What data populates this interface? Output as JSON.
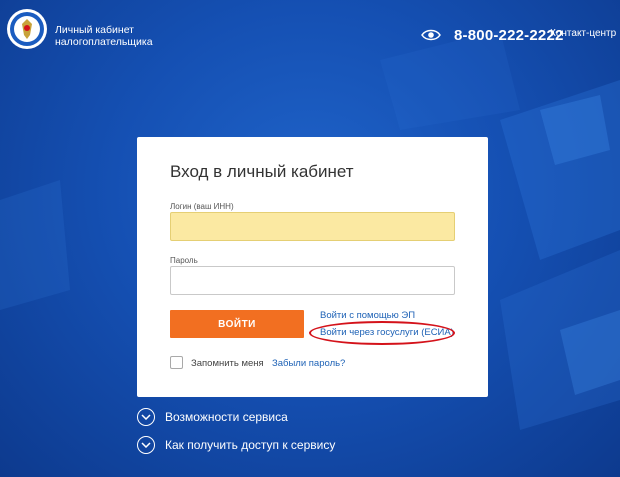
{
  "header": {
    "brand_line1": "Личный кабинет",
    "brand_line2": "налогоплательщика",
    "phone": "8-800-222-2222",
    "contact_center": "Контакт-центр",
    "icons": {
      "logo": "fns-emblem-icon",
      "accessibility": "eye-icon"
    }
  },
  "login": {
    "title": "Вход в личный кабинет",
    "login_label": "Логин (ваш ИНН)",
    "login_value": "",
    "password_label": "Пароль",
    "password_value": "",
    "submit": "ВОЙТИ",
    "ep_link": "Войти с помощью ЭП",
    "esia_link": "Войти через госуслуги (ЕСИА)",
    "remember": "Запомнить меня",
    "forgot": "Забыли пароль?"
  },
  "footer": {
    "items": [
      {
        "label": "Возможности сервиса",
        "icon": "chevron-down-icon"
      },
      {
        "label": "Как получить доступ к сервису",
        "icon": "chevron-down-icon"
      }
    ]
  },
  "colors": {
    "background": "#1550b3",
    "accent_orange": "#f26f21",
    "link_blue": "#1e62b6",
    "highlight_red": "#d4121a",
    "login_field_fill": "#fbe9a2"
  }
}
